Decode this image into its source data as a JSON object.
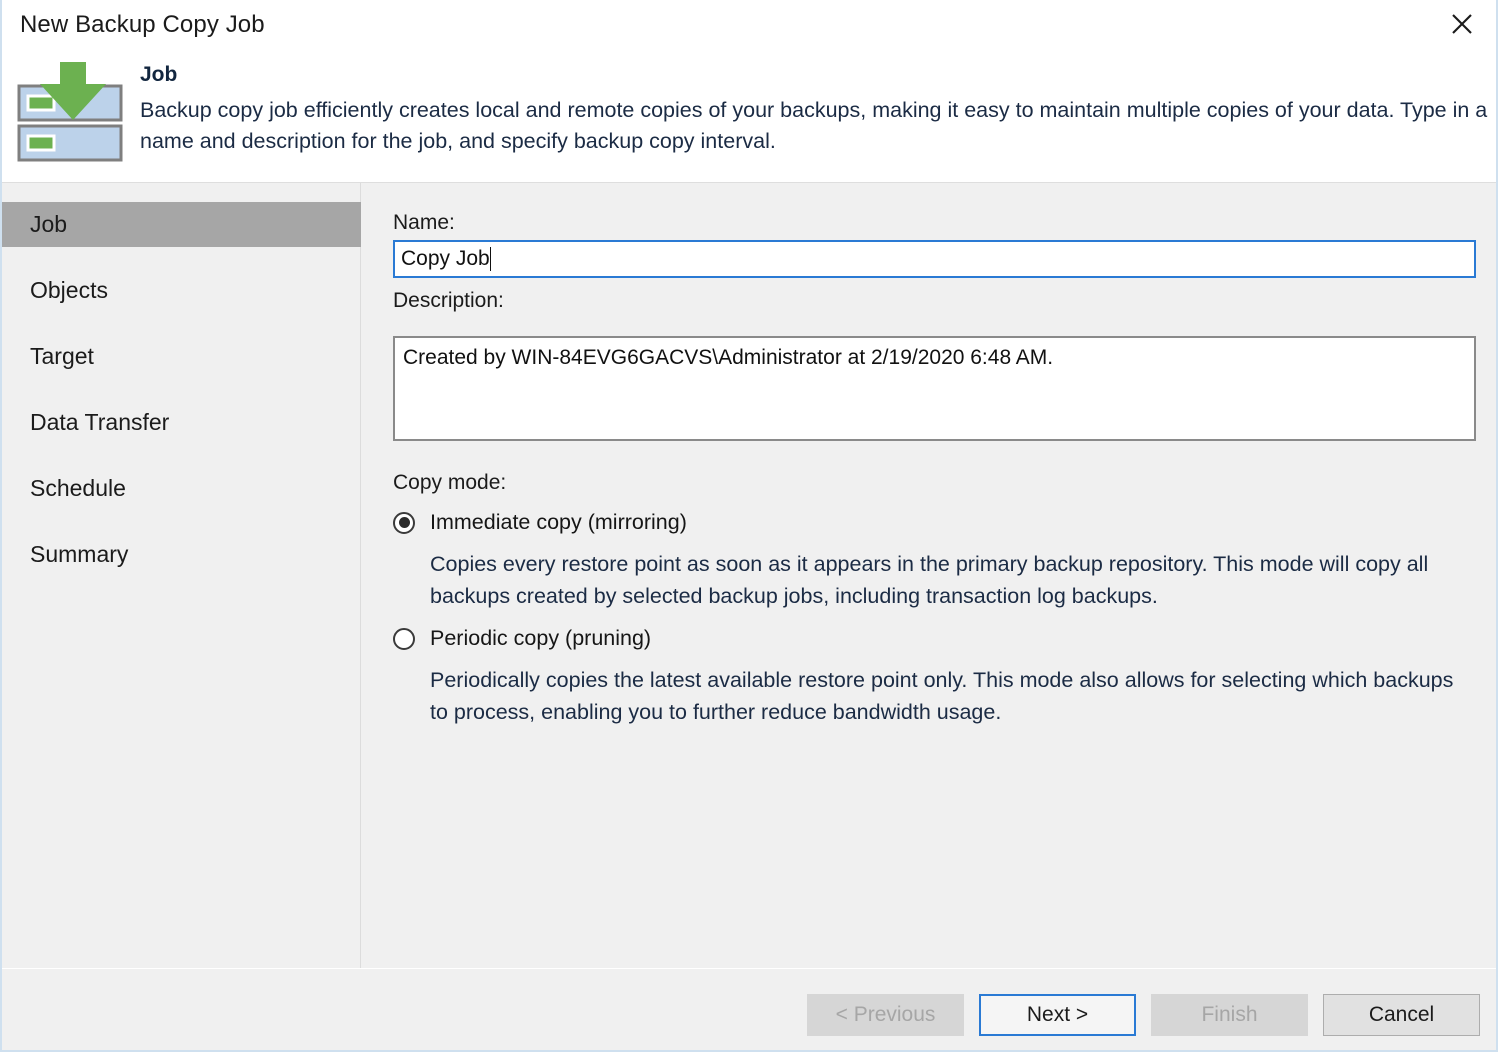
{
  "window": {
    "title": "New Backup Copy Job",
    "close_icon": "close-icon"
  },
  "header": {
    "icon": "backup-copy-arrow-down-icon",
    "title": "Job",
    "description": "Backup copy job efficiently creates local and remote copies of your backups, making it easy to maintain multiple copies of your data. Type in a name and description for the job, and specify backup copy interval."
  },
  "sidebar": {
    "items": [
      {
        "label": "Job",
        "active": true
      },
      {
        "label": "Objects",
        "active": false
      },
      {
        "label": "Target",
        "active": false
      },
      {
        "label": "Data Transfer",
        "active": false
      },
      {
        "label": "Schedule",
        "active": false
      },
      {
        "label": "Summary",
        "active": false
      }
    ]
  },
  "form": {
    "name_label": "Name:",
    "name_value": "Copy Job",
    "name_placeholder": "",
    "description_label": "Description:",
    "description_value": "Created by WIN-84EVG6GACVS\\Administrator at 2/19/2020 6:48 AM.",
    "description_placeholder": "",
    "copy_mode_label": "Copy mode:",
    "copy_mode_options": [
      {
        "label": "Immediate copy (mirroring)",
        "selected": true,
        "description": "Copies every restore point as soon as it appears in the primary backup repository. This mode will copy all backups created by selected backup jobs, including transaction log backups."
      },
      {
        "label": "Periodic copy (pruning)",
        "selected": false,
        "description": "Periodically copies the latest available restore point only. This mode also allows for selecting which backups to process, enabling you to further reduce bandwidth usage."
      }
    ]
  },
  "footer": {
    "buttons": [
      {
        "label": "< Previous",
        "state": "disabled"
      },
      {
        "label": "Next >",
        "state": "focused"
      },
      {
        "label": "Finish",
        "state": "disabled"
      },
      {
        "label": "Cancel",
        "state": "normal"
      }
    ]
  },
  "colors": {
    "accent_blue": "#2a7ad4",
    "icon_green": "#6cb150",
    "icon_blue": "#bcd2ea",
    "sidebar_bg": "#f0f0f0",
    "sidebar_active": "#a6a6a6",
    "window_border": "#cfe0ef"
  }
}
